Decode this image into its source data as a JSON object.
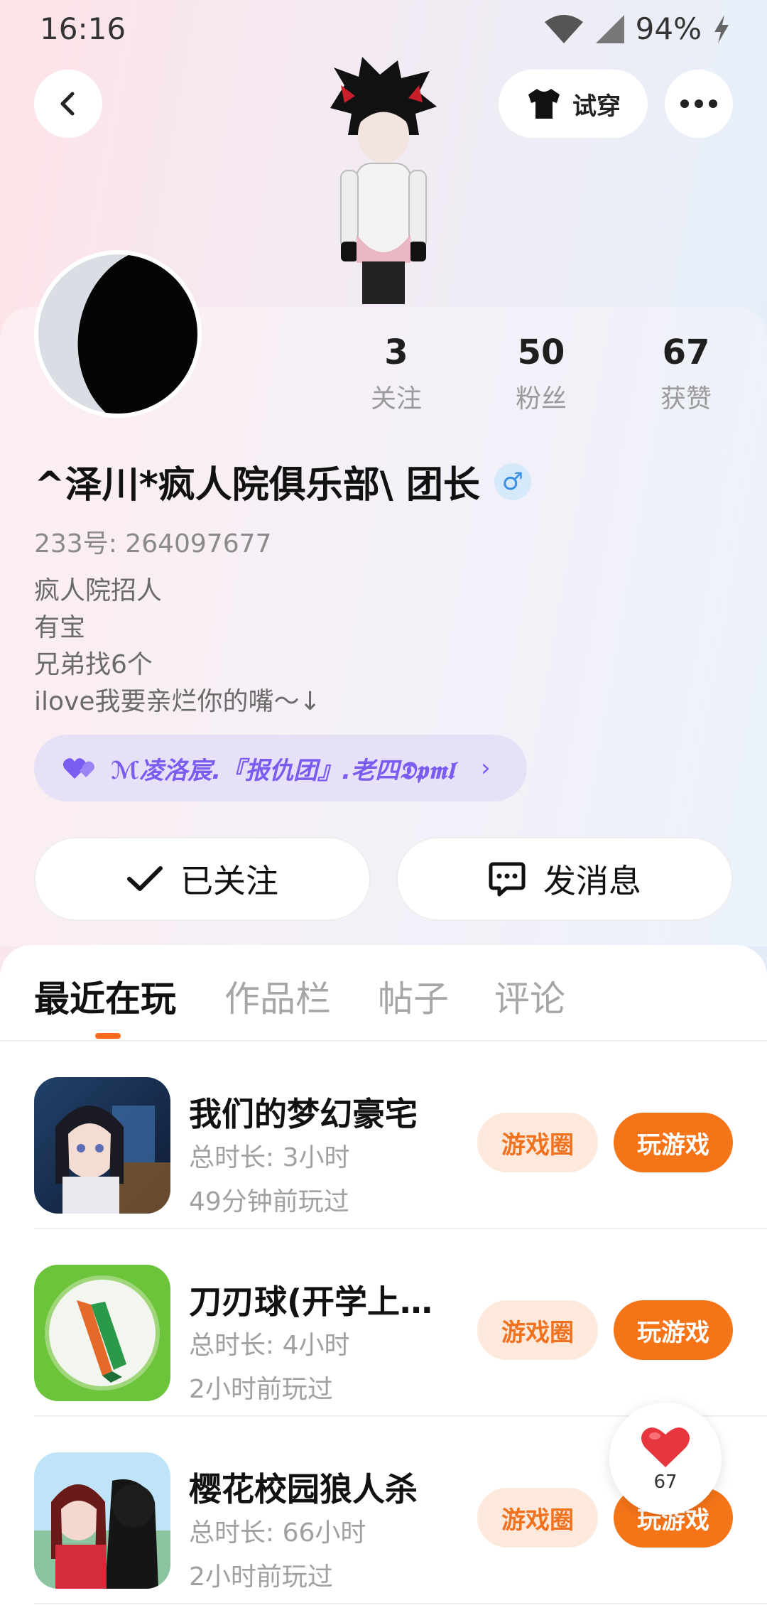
{
  "status_bar": {
    "time": "16:16",
    "battery": "94%"
  },
  "header": {
    "try_on_label": "试穿"
  },
  "profile": {
    "stats": [
      {
        "value": "3",
        "label": "关注"
      },
      {
        "value": "50",
        "label": "粉丝"
      },
      {
        "value": "67",
        "label": "获赞"
      }
    ],
    "username": "^泽川*疯人院俱乐部\\ 团长",
    "gender_symbol": "♂",
    "uid": "233号: 264097677",
    "bio": [
      "疯人院招人",
      "有宝",
      "兄弟找6个",
      "ilove我要亲烂你的嘴～↓"
    ],
    "guild": "ℳ凌洛宸.『报仇团』.老四𝕯𝖕𝖒𝖑",
    "follow_label": "已关注",
    "message_label": "发消息"
  },
  "tabs": [
    {
      "label": "最近在玩",
      "active": true
    },
    {
      "label": "作品栏",
      "active": false
    },
    {
      "label": "帖子",
      "active": false
    },
    {
      "label": "评论",
      "active": false
    }
  ],
  "games": [
    {
      "title": "我们的梦幻豪宅",
      "duration": "总时长: 3小时",
      "last_played": "49分钟前玩过",
      "circle_label": "游戏圈",
      "play_label": "玩游戏"
    },
    {
      "title": "刀刃球(开学上…",
      "duration": "总时长: 4小时",
      "last_played": "2小时前玩过",
      "circle_label": "游戏圈",
      "play_label": "玩游戏"
    },
    {
      "title": "樱花校园狼人杀",
      "duration": "总时长: 66小时",
      "last_played": "2小时前玩过",
      "circle_label": "游戏圈",
      "play_label": "玩游戏"
    }
  ],
  "like_float": {
    "count": "67"
  },
  "colors": {
    "accent": "#f57418",
    "guild": "#7a5cf0",
    "like": "#e8363f"
  }
}
